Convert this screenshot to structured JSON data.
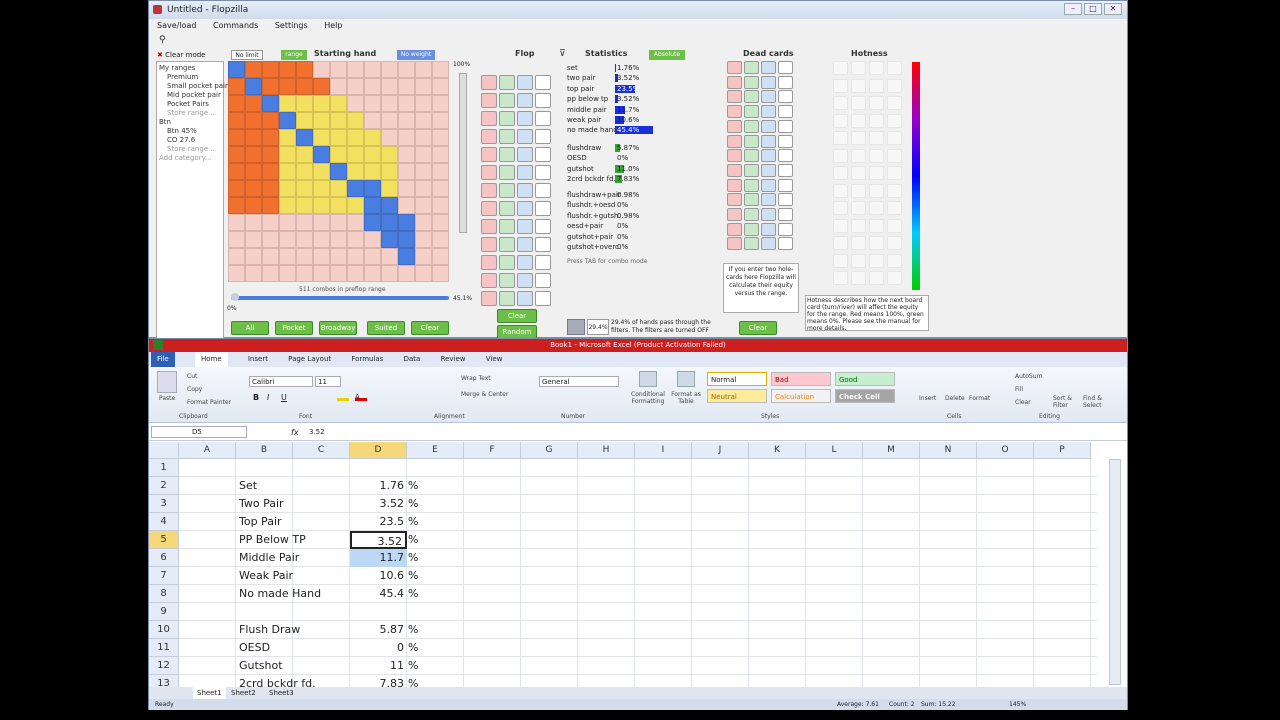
{
  "flopzilla": {
    "title": "Untitled - Flopzilla",
    "menu": [
      "Save/load",
      "Commands",
      "Settings",
      "Help"
    ],
    "clear_mode": "Clear mode",
    "tree": [
      "My ranges",
      "Premium",
      "Small pocket pair",
      "Mid pocket pair",
      "Pocket Pairs",
      "Store range ...",
      "Btn",
      "Btn 45%",
      "CO 27.6",
      "Store range ...",
      "Add category..."
    ],
    "no_limit": "No limit",
    "range_label": "range",
    "starting_hand_title": "Starting hand",
    "no_weight": "No weight",
    "range_pct": "100%",
    "combos_text": "511 combos in preflop range",
    "slider_left": "0%",
    "slider_right": "45.1%",
    "bottom_buttons": [
      "All",
      "Pocket",
      "Broadway",
      "Suited",
      "Clear"
    ],
    "flop_title": "Flop",
    "flop_clear": "Clear",
    "flop_random": "Random",
    "stats_title": "Statistics",
    "absolute": "Absolute",
    "stats": [
      {
        "label": "set",
        "value": "1.76%",
        "pct": 1.76
      },
      {
        "label": "two pair",
        "value": "3.52%",
        "pct": 3.52
      },
      {
        "label": "top pair",
        "value": "23.5%",
        "pct": 23.5
      },
      {
        "label": "pp below tp",
        "value": "3.52%",
        "pct": 3.52
      },
      {
        "label": "middle pair",
        "value": "11.7%",
        "pct": 11.7
      },
      {
        "label": "weak pair",
        "value": "10.6%",
        "pct": 10.6
      },
      {
        "label": "no made hand",
        "value": "45.4%",
        "pct": 45.4
      }
    ],
    "draws": [
      {
        "label": "flushdraw",
        "value": "5.87%",
        "pct": 5.87
      },
      {
        "label": "OESD",
        "value": "0%",
        "pct": 0
      },
      {
        "label": "gutshot",
        "value": "11.0%",
        "pct": 11.0
      },
      {
        "label": "2crd bckdr fd.",
        "value": "7.83%",
        "pct": 7.83
      }
    ],
    "combos": [
      {
        "label": "flushdraw+pair",
        "value": "0.98%"
      },
      {
        "label": "flushdr.+oesd",
        "value": "0%"
      },
      {
        "label": "flushdr.+gutsh.",
        "value": "0.98%"
      },
      {
        "label": "oesd+pair",
        "value": "0%"
      },
      {
        "label": "gutshot+pair",
        "value": "0%"
      },
      {
        "label": "gutshot+overc.",
        "value": "0%"
      }
    ],
    "tab_hint": "Press TAB for combo mode",
    "filter_text": "29.4% of hands pass through the filters. The filters are turned OFF",
    "filter_pct": "29.4%",
    "filter_clear": "Clear",
    "dead_cards_title": "Dead cards",
    "dead_note": "If you enter two hole-cards here Flopzilla will calculate their equity versus the range.",
    "hotness_title": "Hotness",
    "hotness_note": "Hotness describes how the next board card (turn/river) will affect the equity for the range. Red means 100%, green means 0%. Please see the manual for more details."
  },
  "excel": {
    "title": "Book1 - Microsoft Excel (Product Activation Failed)",
    "tabs": [
      "File",
      "Home",
      "Insert",
      "Page Layout",
      "Formulas",
      "Data",
      "Review",
      "View"
    ],
    "clipboard": {
      "cut": "Cut",
      "copy": "Copy",
      "format_painter": "Format Painter",
      "paste": "Paste",
      "label": "Clipboard"
    },
    "font": {
      "name": "Calibri",
      "size": "11",
      "label": "Font"
    },
    "alignment": {
      "wrap": "Wrap Text",
      "merge": "Merge & Center",
      "label": "Alignment"
    },
    "number": {
      "format": "General",
      "label": "Number"
    },
    "styles": {
      "conditional": "Conditional Formatting",
      "format_table": "Format as Table",
      "normal": "Normal",
      "bad": "Bad",
      "good": "Good",
      "neutral": "Neutral",
      "calculation": "Calculation",
      "check_cell": "Check Cell",
      "label": "Styles"
    },
    "cells": {
      "insert": "Insert",
      "delete": "Delete",
      "format": "Format",
      "label": "Cells"
    },
    "editing": {
      "autosum": "AutoSum",
      "fill": "Fill",
      "clear": "Clear",
      "sort": "Sort & Filter",
      "find": "Find & Select",
      "label": "Editing"
    },
    "name_box": "D5",
    "formula_value": "3.52",
    "columns": [
      "A",
      "B",
      "C",
      "D",
      "E",
      "F",
      "G",
      "H",
      "I",
      "J",
      "K",
      "L",
      "M",
      "N",
      "O",
      "P"
    ],
    "rows": [
      {
        "n": "1",
        "b": "",
        "d": "",
        "e": ""
      },
      {
        "n": "2",
        "b": "Set",
        "d": "1.76",
        "e": "%"
      },
      {
        "n": "3",
        "b": "Two Pair",
        "d": "3.52",
        "e": "%"
      },
      {
        "n": "4",
        "b": "Top Pair",
        "d": "23.5",
        "e": "%"
      },
      {
        "n": "5",
        "b": "PP Below TP",
        "d": "3.52",
        "e": "%"
      },
      {
        "n": "6",
        "b": "Middle Pair",
        "d": "11.7",
        "e": "%"
      },
      {
        "n": "7",
        "b": "Weak Pair",
        "d": "10.6",
        "e": "%"
      },
      {
        "n": "8",
        "b": "No made Hand",
        "d": "45.4",
        "e": "%"
      },
      {
        "n": "9",
        "b": "",
        "d": "",
        "e": ""
      },
      {
        "n": "10",
        "b": "Flush Draw",
        "d": "5.87",
        "e": "%"
      },
      {
        "n": "11",
        "b": "OESD",
        "d": "0",
        "e": "%"
      },
      {
        "n": "12",
        "b": "Gutshot",
        "d": "11",
        "e": "%"
      },
      {
        "n": "13",
        "b": "2crd bckdr fd.",
        "d": "7.83",
        "e": "%"
      }
    ],
    "sheets": [
      "Sheet1",
      "Sheet2",
      "Sheet3"
    ],
    "status_ready": "Ready",
    "status_average": "Average: 7.61",
    "status_count": "Count: 2",
    "status_sum": "Sum: 15.22",
    "zoom": "145%"
  }
}
